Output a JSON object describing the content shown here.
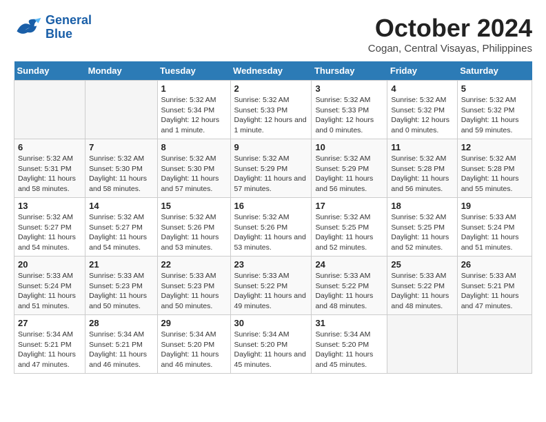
{
  "header": {
    "logo_line1": "General",
    "logo_line2": "Blue",
    "month": "October 2024",
    "location": "Cogan, Central Visayas, Philippines"
  },
  "weekdays": [
    "Sunday",
    "Monday",
    "Tuesday",
    "Wednesday",
    "Thursday",
    "Friday",
    "Saturday"
  ],
  "weeks": [
    [
      {
        "day": "",
        "info": ""
      },
      {
        "day": "",
        "info": ""
      },
      {
        "day": "1",
        "info": "Sunrise: 5:32 AM\nSunset: 5:34 PM\nDaylight: 12 hours and 1 minute."
      },
      {
        "day": "2",
        "info": "Sunrise: 5:32 AM\nSunset: 5:33 PM\nDaylight: 12 hours and 1 minute."
      },
      {
        "day": "3",
        "info": "Sunrise: 5:32 AM\nSunset: 5:33 PM\nDaylight: 12 hours and 0 minutes."
      },
      {
        "day": "4",
        "info": "Sunrise: 5:32 AM\nSunset: 5:32 PM\nDaylight: 12 hours and 0 minutes."
      },
      {
        "day": "5",
        "info": "Sunrise: 5:32 AM\nSunset: 5:32 PM\nDaylight: 11 hours and 59 minutes."
      }
    ],
    [
      {
        "day": "6",
        "info": "Sunrise: 5:32 AM\nSunset: 5:31 PM\nDaylight: 11 hours and 58 minutes."
      },
      {
        "day": "7",
        "info": "Sunrise: 5:32 AM\nSunset: 5:30 PM\nDaylight: 11 hours and 58 minutes."
      },
      {
        "day": "8",
        "info": "Sunrise: 5:32 AM\nSunset: 5:30 PM\nDaylight: 11 hours and 57 minutes."
      },
      {
        "day": "9",
        "info": "Sunrise: 5:32 AM\nSunset: 5:29 PM\nDaylight: 11 hours and 57 minutes."
      },
      {
        "day": "10",
        "info": "Sunrise: 5:32 AM\nSunset: 5:29 PM\nDaylight: 11 hours and 56 minutes."
      },
      {
        "day": "11",
        "info": "Sunrise: 5:32 AM\nSunset: 5:28 PM\nDaylight: 11 hours and 56 minutes."
      },
      {
        "day": "12",
        "info": "Sunrise: 5:32 AM\nSunset: 5:28 PM\nDaylight: 11 hours and 55 minutes."
      }
    ],
    [
      {
        "day": "13",
        "info": "Sunrise: 5:32 AM\nSunset: 5:27 PM\nDaylight: 11 hours and 54 minutes."
      },
      {
        "day": "14",
        "info": "Sunrise: 5:32 AM\nSunset: 5:27 PM\nDaylight: 11 hours and 54 minutes."
      },
      {
        "day": "15",
        "info": "Sunrise: 5:32 AM\nSunset: 5:26 PM\nDaylight: 11 hours and 53 minutes."
      },
      {
        "day": "16",
        "info": "Sunrise: 5:32 AM\nSunset: 5:26 PM\nDaylight: 11 hours and 53 minutes."
      },
      {
        "day": "17",
        "info": "Sunrise: 5:32 AM\nSunset: 5:25 PM\nDaylight: 11 hours and 52 minutes."
      },
      {
        "day": "18",
        "info": "Sunrise: 5:32 AM\nSunset: 5:25 PM\nDaylight: 11 hours and 52 minutes."
      },
      {
        "day": "19",
        "info": "Sunrise: 5:33 AM\nSunset: 5:24 PM\nDaylight: 11 hours and 51 minutes."
      }
    ],
    [
      {
        "day": "20",
        "info": "Sunrise: 5:33 AM\nSunset: 5:24 PM\nDaylight: 11 hours and 51 minutes."
      },
      {
        "day": "21",
        "info": "Sunrise: 5:33 AM\nSunset: 5:23 PM\nDaylight: 11 hours and 50 minutes."
      },
      {
        "day": "22",
        "info": "Sunrise: 5:33 AM\nSunset: 5:23 PM\nDaylight: 11 hours and 50 minutes."
      },
      {
        "day": "23",
        "info": "Sunrise: 5:33 AM\nSunset: 5:22 PM\nDaylight: 11 hours and 49 minutes."
      },
      {
        "day": "24",
        "info": "Sunrise: 5:33 AM\nSunset: 5:22 PM\nDaylight: 11 hours and 48 minutes."
      },
      {
        "day": "25",
        "info": "Sunrise: 5:33 AM\nSunset: 5:22 PM\nDaylight: 11 hours and 48 minutes."
      },
      {
        "day": "26",
        "info": "Sunrise: 5:33 AM\nSunset: 5:21 PM\nDaylight: 11 hours and 47 minutes."
      }
    ],
    [
      {
        "day": "27",
        "info": "Sunrise: 5:34 AM\nSunset: 5:21 PM\nDaylight: 11 hours and 47 minutes."
      },
      {
        "day": "28",
        "info": "Sunrise: 5:34 AM\nSunset: 5:21 PM\nDaylight: 11 hours and 46 minutes."
      },
      {
        "day": "29",
        "info": "Sunrise: 5:34 AM\nSunset: 5:20 PM\nDaylight: 11 hours and 46 minutes."
      },
      {
        "day": "30",
        "info": "Sunrise: 5:34 AM\nSunset: 5:20 PM\nDaylight: 11 hours and 45 minutes."
      },
      {
        "day": "31",
        "info": "Sunrise: 5:34 AM\nSunset: 5:20 PM\nDaylight: 11 hours and 45 minutes."
      },
      {
        "day": "",
        "info": ""
      },
      {
        "day": "",
        "info": ""
      }
    ]
  ]
}
